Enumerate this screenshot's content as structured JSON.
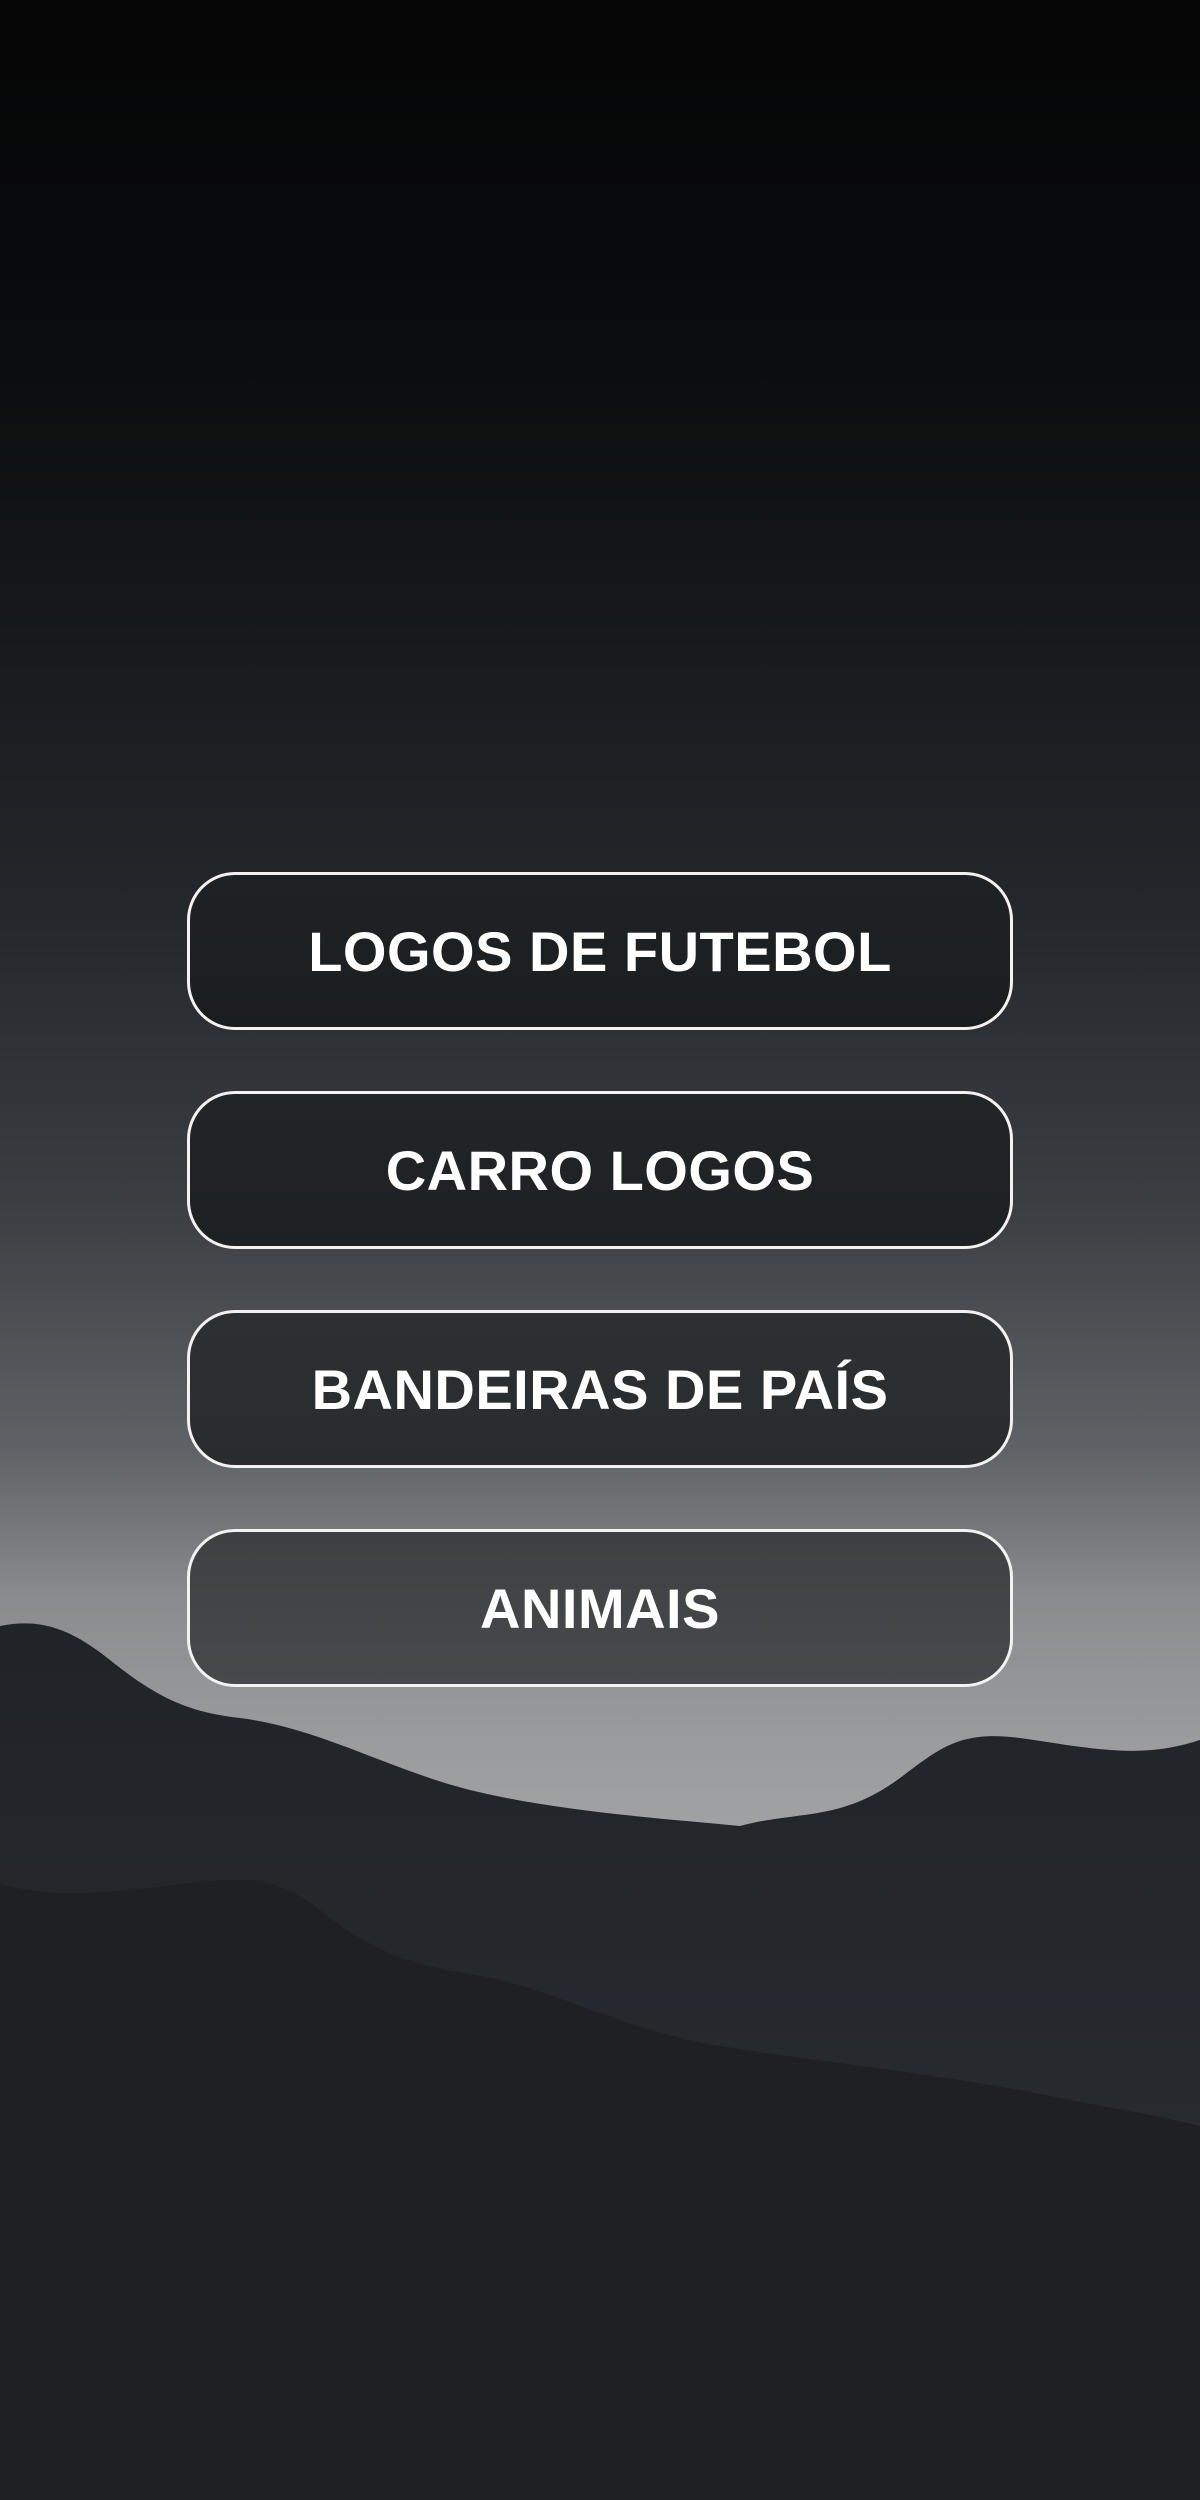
{
  "menu": {
    "buttons": [
      {
        "label": "LOGOS DE FUTEBOL"
      },
      {
        "label": "CARRO LOGOS"
      },
      {
        "label": "BANDEIRAS DE PAÍS"
      },
      {
        "label": "ANIMAIS"
      }
    ]
  },
  "colors": {
    "background_top": "#050505",
    "background_horizon": "#a2a3a5",
    "mountain_back": "#23262b",
    "mountain_front": "#1e2024",
    "button_border": "#f2f2f2",
    "button_text": "#ffffff"
  }
}
